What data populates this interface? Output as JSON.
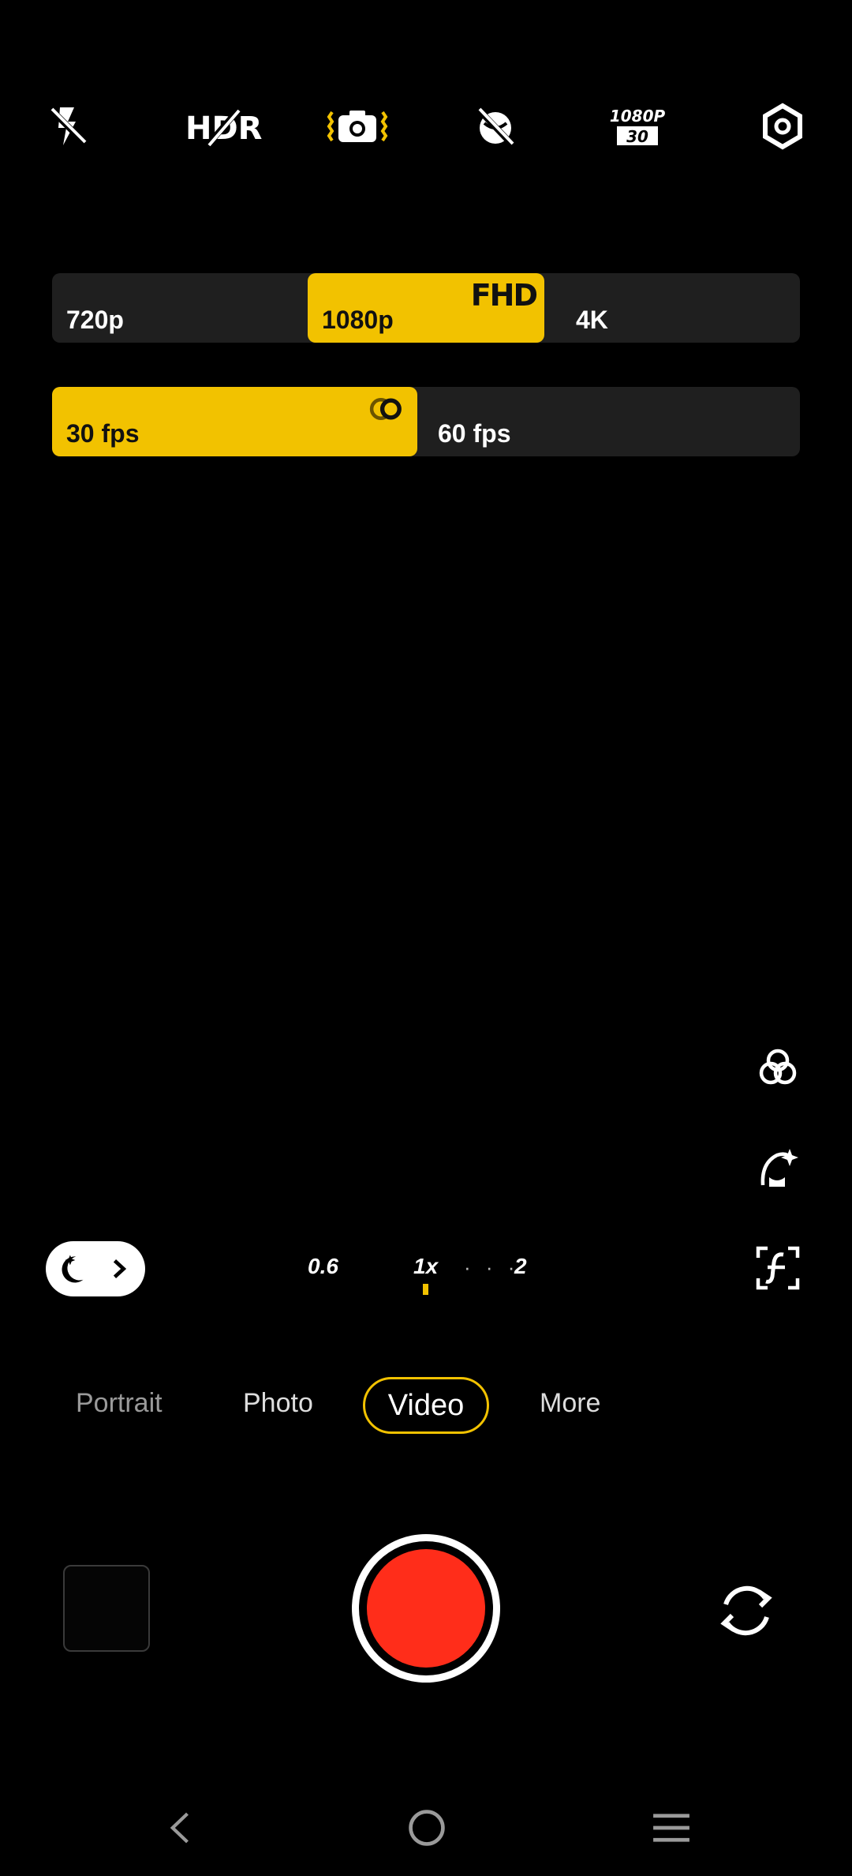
{
  "toolbar": {
    "icons": [
      "flash-off-icon",
      "hdr-off-icon",
      "stabilization-icon",
      "filter-off-icon",
      "video-quality-icon",
      "settings-icon"
    ],
    "quality_badge_top": "1080P",
    "quality_badge_bottom": "30",
    "hdr_label": "HDR",
    "accent": "#f2c200"
  },
  "resolution": {
    "options": [
      "720p",
      "1080p",
      "4K"
    ],
    "selected": "1080p",
    "badge": "FHD"
  },
  "fps": {
    "options": [
      "30 fps",
      "60 fps"
    ],
    "selected": "30 fps"
  },
  "zoom": {
    "levels": [
      "0.6",
      "1x",
      "2"
    ],
    "selected": "1x",
    "dots": "· · ·"
  },
  "modes": {
    "items": [
      "Portrait",
      "Photo",
      "Video",
      "More"
    ],
    "selected": "Video"
  },
  "colors": {
    "record": "#ff2d1a",
    "accent": "#f2c200",
    "bar_bg": "#1f1f1f"
  }
}
